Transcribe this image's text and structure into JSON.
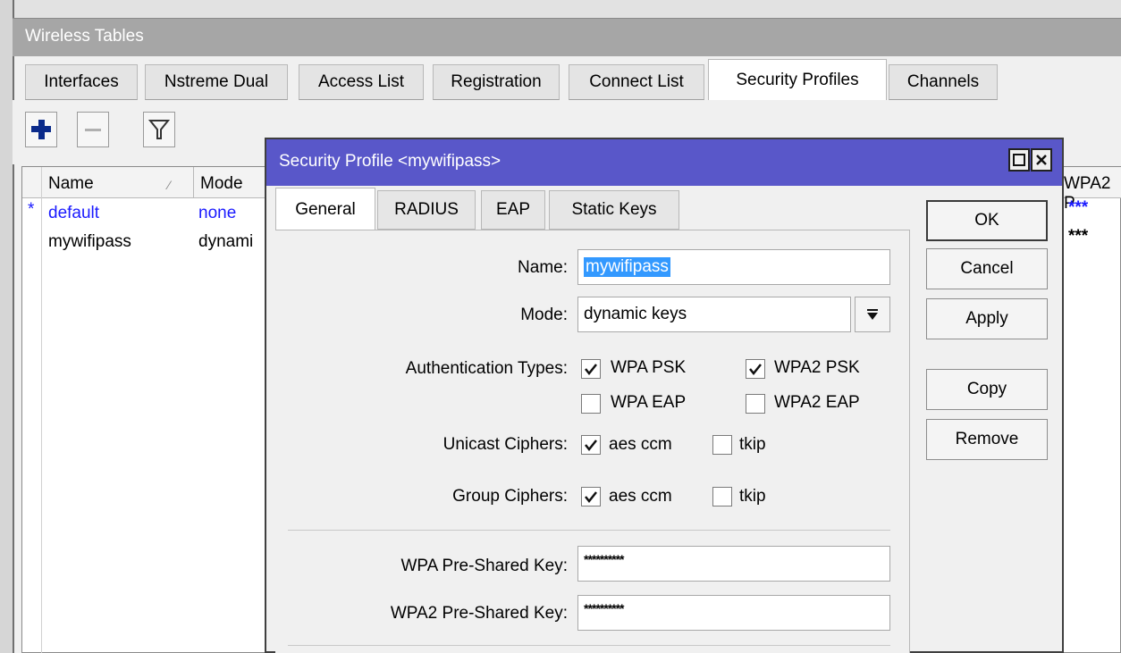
{
  "window": {
    "title": "Wireless Tables"
  },
  "tabs": [
    {
      "label": "Interfaces"
    },
    {
      "label": "Nstreme Dual"
    },
    {
      "label": "Access List"
    },
    {
      "label": "Registration"
    },
    {
      "label": "Connect List"
    },
    {
      "label": "Security Profiles",
      "active": true
    },
    {
      "label": "Channels"
    }
  ],
  "toolbar": {
    "add_icon": "plus-icon",
    "remove_icon": "minus-icon",
    "filter_icon": "filter-icon"
  },
  "table": {
    "columns": [
      "Name",
      "Mode",
      "WPA2 P"
    ],
    "sort_indicator": "⁄",
    "rows": [
      {
        "marker": "*",
        "name": "default",
        "mode": "none",
        "key": "***"
      },
      {
        "marker": "",
        "name": "mywifipass",
        "mode": "dynami",
        "key": "***"
      }
    ]
  },
  "dialog": {
    "title": "Security Profile <mywifipass>",
    "tabs": [
      "General",
      "RADIUS",
      "EAP",
      "Static Keys"
    ],
    "name_label": "Name:",
    "name_value": "mywifipass",
    "mode_label": "Mode:",
    "mode_value": "dynamic keys",
    "auth_label": "Authentication Types:",
    "auth": {
      "wpa_psk": {
        "label": "WPA PSK",
        "checked": true
      },
      "wpa2_psk": {
        "label": "WPA2 PSK",
        "checked": true
      },
      "wpa_eap": {
        "label": "WPA EAP",
        "checked": false
      },
      "wpa2_eap": {
        "label": "WPA2 EAP",
        "checked": false
      }
    },
    "unicast_label": "Unicast Ciphers:",
    "unicast": {
      "aes": {
        "label": "aes ccm",
        "checked": true
      },
      "tkip": {
        "label": "tkip",
        "checked": false
      }
    },
    "group_label": "Group Ciphers:",
    "group": {
      "aes": {
        "label": "aes ccm",
        "checked": true
      },
      "tkip": {
        "label": "tkip",
        "checked": false
      }
    },
    "wpa_key_label": "WPA Pre-Shared Key:",
    "wpa_key_value": "**********",
    "wpa2_key_label": "WPA2 Pre-Shared Key:",
    "wpa2_key_value": "**********",
    "buttons": {
      "ok": "OK",
      "cancel": "Cancel",
      "apply": "Apply",
      "copy": "Copy",
      "remove": "Remove"
    }
  },
  "colors": {
    "title_bar": "#5957c9",
    "link_blue": "#1a1aff",
    "selection": "#3399ff"
  }
}
